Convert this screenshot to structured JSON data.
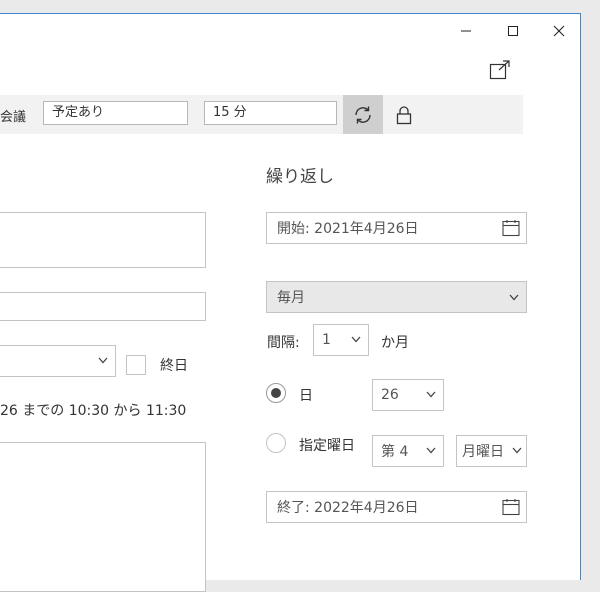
{
  "toolbar": {
    "meeting_label": "会議",
    "status_value": "予定あり",
    "reminder_value": "15 分"
  },
  "left": {
    "endday_label": "終日",
    "summary_text": "26 までの  10:30 から 11:30"
  },
  "recurrence": {
    "heading": "繰り返し",
    "start_date": "開始: 2021年4月26日",
    "frequency": "毎月",
    "interval_label": "間隔:",
    "interval_value": "1",
    "interval_unit": "か月",
    "day_label": "日",
    "day_value": "26",
    "weekday_label": "指定曜日",
    "week_ordinal": "第 4",
    "weekday_value": "月曜日",
    "end_date": "終了: 2022年4月26日",
    "day_selected": true
  }
}
